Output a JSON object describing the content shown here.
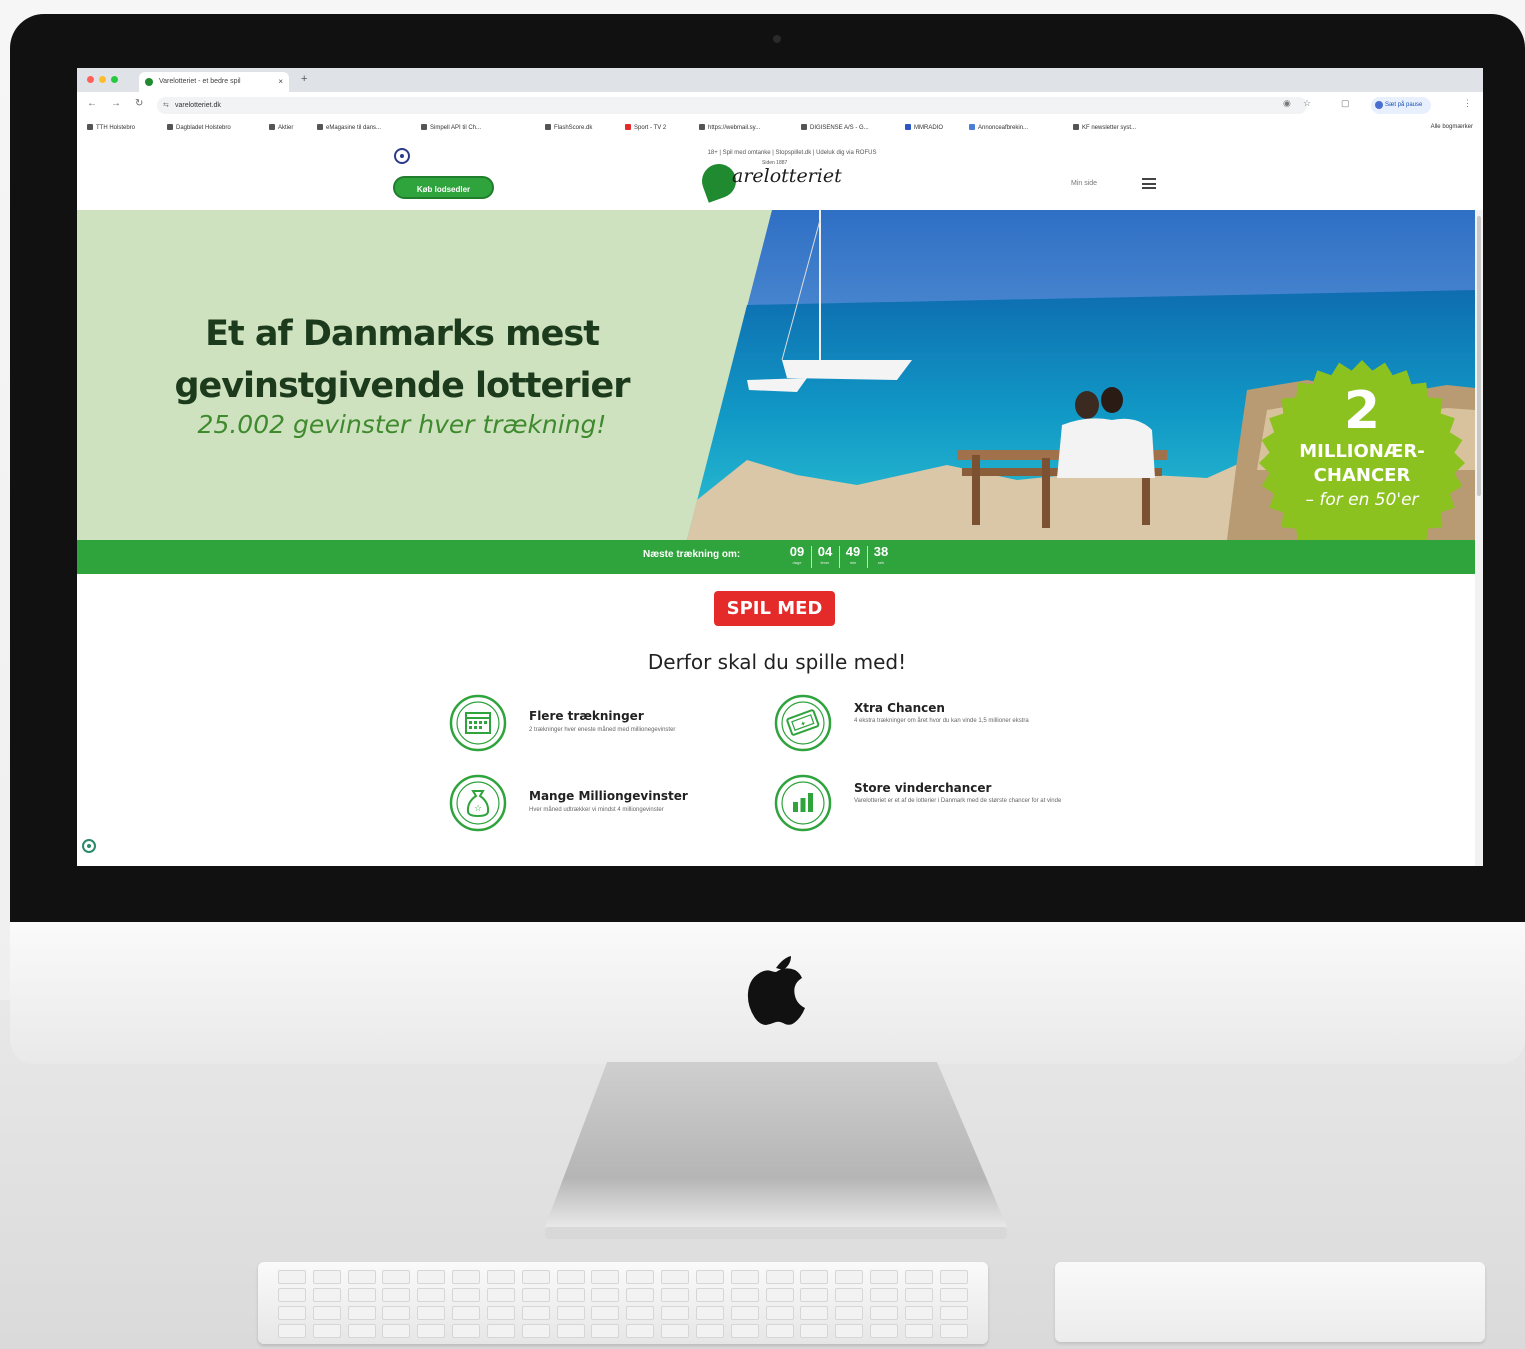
{
  "browser": {
    "tab_title": "Varelotteriet - et bedre spil",
    "tab_close": "×",
    "new_tab": "+",
    "url": "varelotteriet.dk",
    "profile_label": "Sæt på pause",
    "bookmarks": [
      "TTH Holstebro",
      "Dagbladet Holstebro",
      "Aktier",
      "eMagasine til dans...",
      "Simpell API til Ch...",
      "FlashScore.dk",
      "Sport - TV 2",
      "https://webmail.sy...",
      "DIGISENSE A/S - G...",
      "MMRADIO",
      "Annonceafbrekin...",
      "KF newsletter syst..."
    ],
    "all_bookmarks": "Alle bogmærker"
  },
  "site": {
    "top_notice": "18+ | Spil med omtanke | Stopspillet.dk | Udeluk dig via ROFUS",
    "buy_button": "Køb lodsedler",
    "logo_text": "arelotteriet",
    "logo_small": "Siden 1887",
    "my_page": "Min side"
  },
  "hero": {
    "title_line1": "Et af Danmarks mest",
    "title_line2": "gevinstgivende lotterier",
    "subtitle": "25.002 gevinster hver trækning!",
    "badge_number": "2",
    "badge_line1": "MILLIONÆR-",
    "badge_line2": "CHANCER",
    "badge_line3": "– for en 50'er"
  },
  "countdown": {
    "label": "Næste trækning om:",
    "units": [
      {
        "value": "09",
        "unit": "dage"
      },
      {
        "value": "04",
        "unit": "timer"
      },
      {
        "value": "49",
        "unit": "min"
      },
      {
        "value": "38",
        "unit": "sek"
      }
    ]
  },
  "content": {
    "play_button": "SPIL MED",
    "heading": "Derfor skal du spille med!",
    "features": [
      {
        "title": "Flere trækninger",
        "desc": "2 trækninger hver eneste måned med millionegevinster",
        "icon": "calendar-icon"
      },
      {
        "title": "Xtra Chancen",
        "desc": "4 ekstra trækninger om året hvor du kan vinde 1,5 millioner ekstra",
        "icon": "ticket-icon"
      },
      {
        "title": "Mange Milliongevinster",
        "desc": "Hver måned udtrækker vi mindst 4 milliongevinster",
        "icon": "money-bag-icon"
      },
      {
        "title": "Store vinderchancer",
        "desc": "Varelotteriet er et af de lotterier i Danmark med de største chancer for at vinde",
        "icon": "bar-chart-icon"
      }
    ]
  },
  "colors": {
    "brand_green": "#2fa33c",
    "hero_bg": "#cfe2bf",
    "play_red": "#e52a2a",
    "badge_green": "#8cc21f"
  }
}
